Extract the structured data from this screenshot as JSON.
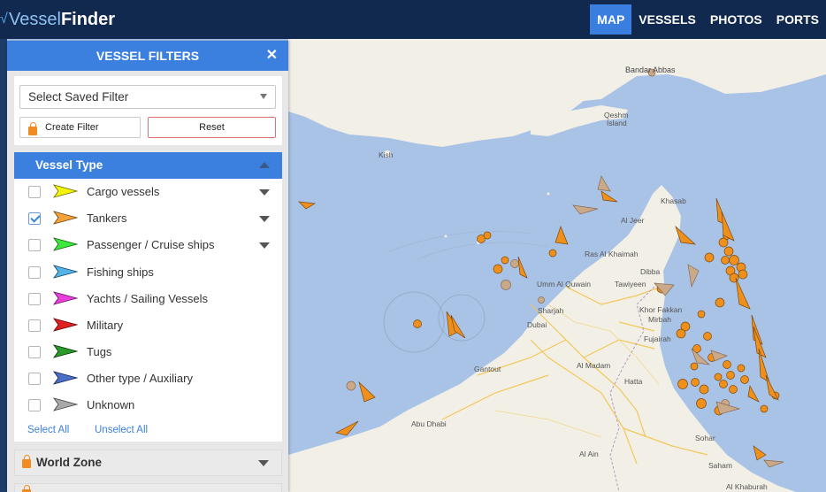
{
  "brand": {
    "light": "Vessel",
    "bold": "Finder"
  },
  "nav": [
    {
      "label": "MAP",
      "active": true
    },
    {
      "label": "VESSELS",
      "active": false
    },
    {
      "label": "PHOTOS",
      "active": false
    },
    {
      "label": "PORTS",
      "active": false
    }
  ],
  "panel": {
    "title": "VESSEL FILTERS",
    "close_icon": "close-icon",
    "saved_filter": {
      "value": "Select Saved Filter"
    },
    "create_filter_label": "Create Filter",
    "reset_label": "Reset",
    "vessel_type": {
      "title": "Vessel Type",
      "items": [
        {
          "label": "Cargo vessels",
          "checked": false,
          "color": "#f5f50a",
          "expandable": true
        },
        {
          "label": "Tankers",
          "checked": true,
          "color": "#f5a23a",
          "expandable": true
        },
        {
          "label": "Passenger / Cruise ships",
          "checked": false,
          "color": "#3ee63e",
          "expandable": true
        },
        {
          "label": "Fishing ships",
          "checked": false,
          "color": "#54b3e8",
          "expandable": false
        },
        {
          "label": "Yachts / Sailing Vessels",
          "checked": false,
          "color": "#e83fd8",
          "expandable": false
        },
        {
          "label": "Military",
          "checked": false,
          "color": "#e02020",
          "expandable": false
        },
        {
          "label": "Tugs",
          "checked": false,
          "color": "#2a9a2a",
          "expandable": false
        },
        {
          "label": "Other type / Auxiliary",
          "checked": false,
          "color": "#4a6fc8",
          "expandable": false
        },
        {
          "label": "Unknown",
          "checked": false,
          "color": "#a8a8a8",
          "expandable": false
        }
      ],
      "select_all": "Select All",
      "unselect_all": "Unselect All"
    },
    "world_zone": {
      "title": "World Zone"
    }
  },
  "map": {
    "labels": [
      {
        "text": "Bandar Abbas"
      },
      {
        "text": "Qeshm"
      },
      {
        "text": "Island"
      },
      {
        "text": "Kish"
      },
      {
        "text": "Khasab"
      },
      {
        "text": "Al Jeer"
      },
      {
        "text": "Ras Al Khaimah"
      },
      {
        "text": "Dibba"
      },
      {
        "text": "Umm Al Quwain"
      },
      {
        "text": "Tawiyeen"
      },
      {
        "text": "Khor Fakkan"
      },
      {
        "text": "Mirbah"
      },
      {
        "text": "Sharjah"
      },
      {
        "text": "Dubai"
      },
      {
        "text": "Fujairah"
      },
      {
        "text": "Gantout"
      },
      {
        "text": "Al Madam"
      },
      {
        "text": "Hatta"
      },
      {
        "text": "Abu Dhabi"
      },
      {
        "text": "Sohar"
      },
      {
        "text": "Al Ain"
      },
      {
        "text": "Saham"
      },
      {
        "text": "Al Khaburah"
      }
    ],
    "colors": {
      "water": "#a9c3e6",
      "land": "#f1efe6",
      "tanker": "#f0901c",
      "tanker_idle": "#c9a98a"
    }
  }
}
